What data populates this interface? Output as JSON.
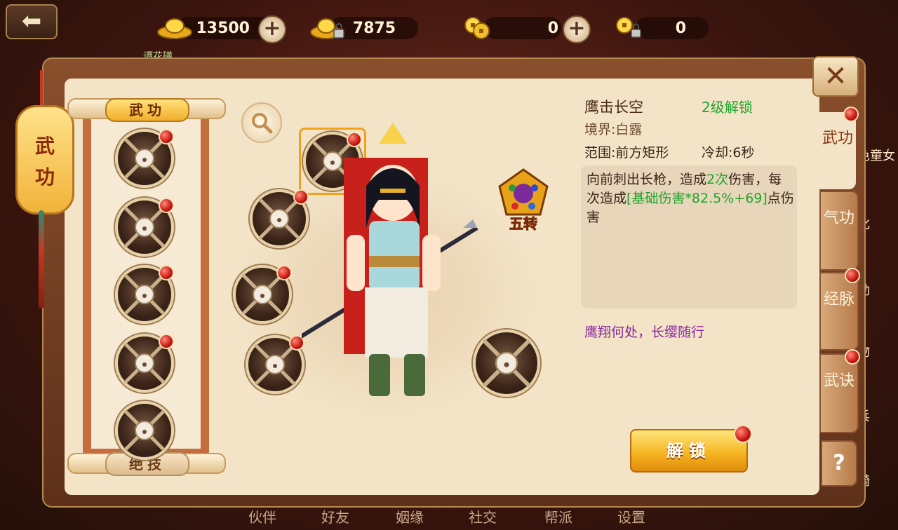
{
  "currency": {
    "gold": "13500",
    "bound_gold": "7875",
    "coins": "0",
    "bound_coins": "0",
    "plus_symbol": "+"
  },
  "background": {
    "deco_text": "谭花磺",
    "side_labels": [
      "色童女",
      "化",
      "动",
      "物",
      "兵",
      "骑"
    ]
  },
  "bottom_nav": [
    "伙伴",
    "好友",
    "姻缘",
    "社交",
    "帮派",
    "设置"
  ],
  "banner": {
    "char1": "武",
    "char2": "功"
  },
  "left_list": {
    "top_tab": "武功",
    "bottom_tab": "绝技"
  },
  "skill": {
    "name": "鹰击长空",
    "unlock_level": "2级解锁",
    "realm": "境界:白露",
    "range": "范围:前方矩形",
    "cooldown": "冷却:6秒",
    "desc_1": "向前刺出长枪，造成",
    "desc_hits": "2次",
    "desc_2": "伤害，每次造成",
    "desc_formula": "[基础伤害*82.5%+69]",
    "desc_3": "点伤害",
    "slogan": "鹰翔何处，长缨随行"
  },
  "emblem_label": "五转",
  "unlock_button": "解锁",
  "right_tabs": [
    "武功",
    "气功",
    "经脉",
    "武诀"
  ],
  "help_label": "?",
  "close_label": "✕",
  "back_label": "⬅",
  "colors": {
    "panel_bg": "#f3e4c8",
    "accent_green": "#1ea42a",
    "accent_purple": "#8a2a9e",
    "gold_button": "#f5b21e",
    "red_dot": "#c8160e"
  }
}
